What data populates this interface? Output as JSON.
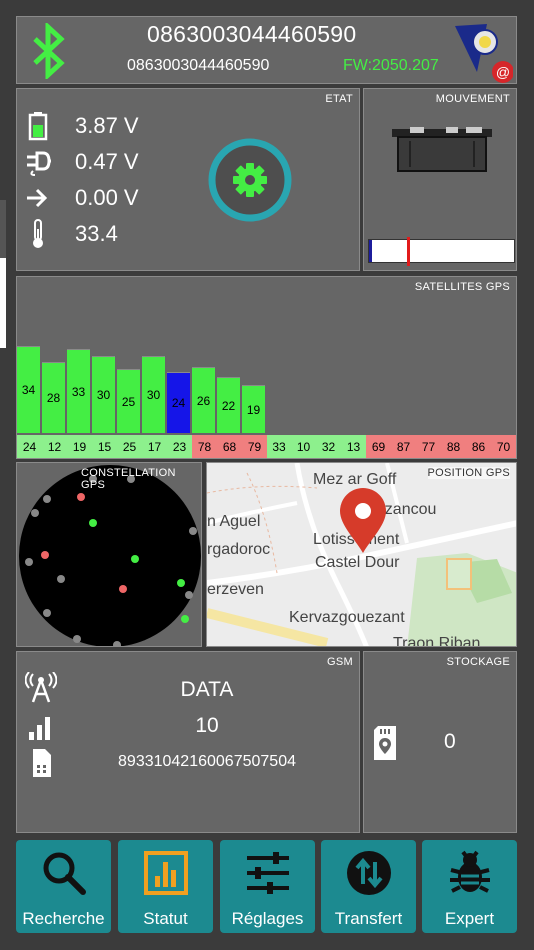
{
  "header": {
    "imei_main": "0863003044460590",
    "imei_sub": "0863003044460590",
    "firmware": "FW:2050.207",
    "logo_badge": "@"
  },
  "etat": {
    "title": "ETAT",
    "battery_voltage": "3.87 V",
    "power_voltage": "0.47 V",
    "input_voltage": "0.00 V",
    "temperature": "33.4"
  },
  "mouvement": {
    "title": "MOUVEMENT",
    "level": 0.26
  },
  "satellites": {
    "title": "SATELLITES GPS",
    "bars": [
      {
        "snr": "34",
        "id": "24",
        "level": 34,
        "color": "#44ee44",
        "label_color": "#8df08d"
      },
      {
        "snr": "28",
        "id": "12",
        "level": 28,
        "color": "#44ee44",
        "label_color": "#8df08d"
      },
      {
        "snr": "33",
        "id": "19",
        "level": 33,
        "color": "#44ee44",
        "label_color": "#8df08d"
      },
      {
        "snr": "30",
        "id": "15",
        "level": 30,
        "color": "#44ee44",
        "label_color": "#8df08d"
      },
      {
        "snr": "25",
        "id": "25",
        "level": 25,
        "color": "#44ee44",
        "label_color": "#8df08d"
      },
      {
        "snr": "30",
        "id": "17",
        "level": 30,
        "color": "#44ee44",
        "label_color": "#8df08d"
      },
      {
        "snr": "24",
        "id": "23",
        "level": 24,
        "color": "#1515e8",
        "label_color": "#8df08d"
      },
      {
        "snr": "26",
        "id": "78",
        "level": 26,
        "color": "#44ee44",
        "label_color": "#f07f7f"
      },
      {
        "snr": "22",
        "id": "68",
        "level": 22,
        "color": "#44ee44",
        "label_color": "#f07f7f"
      },
      {
        "snr": "19",
        "id": "79",
        "level": 19,
        "color": "#44ee44",
        "label_color": "#f07f7f"
      },
      {
        "snr": "",
        "id": "33",
        "level": 0,
        "color": "#44ee44",
        "label_color": "#8df08d"
      },
      {
        "snr": "",
        "id": "10",
        "level": 0,
        "color": "#44ee44",
        "label_color": "#8df08d"
      },
      {
        "snr": "",
        "id": "32",
        "level": 0,
        "color": "#44ee44",
        "label_color": "#8df08d"
      },
      {
        "snr": "",
        "id": "13",
        "level": 0,
        "color": "#44ee44",
        "label_color": "#8df08d"
      },
      {
        "snr": "",
        "id": "69",
        "level": 0,
        "color": "#44ee44",
        "label_color": "#f07f7f"
      },
      {
        "snr": "",
        "id": "87",
        "level": 0,
        "color": "#44ee44",
        "label_color": "#f07f7f"
      },
      {
        "snr": "",
        "id": "77",
        "level": 0,
        "color": "#44ee44",
        "label_color": "#f07f7f"
      },
      {
        "snr": "",
        "id": "88",
        "level": 0,
        "color": "#44ee44",
        "label_color": "#f07f7f"
      },
      {
        "snr": "",
        "id": "86",
        "level": 0,
        "color": "#44ee44",
        "label_color": "#f07f7f"
      },
      {
        "snr": "",
        "id": "70",
        "level": 0,
        "color": "#44ee44",
        "label_color": "#f07f7f"
      }
    ]
  },
  "constellation": {
    "title": "CONSTELLATION GPS"
  },
  "position": {
    "title": "POSITION GPS",
    "places": [
      "Mez ar Goff",
      "Lezancou",
      "n Aguel",
      "rgadoroc",
      "Lotissement",
      "Castel Dour",
      "erzeven",
      "Kervazgouezant",
      "Traon Riban"
    ]
  },
  "gsm": {
    "title": "GSM",
    "mode": "DATA",
    "signal": "10",
    "iccid": "89331042160067507504"
  },
  "stockage": {
    "title": "STOCKAGE",
    "count": "0"
  },
  "nav": [
    {
      "label": "Recherche",
      "icon": "search-icon"
    },
    {
      "label": "Statut",
      "icon": "chart-icon"
    },
    {
      "label": "Réglages",
      "icon": "sliders-icon"
    },
    {
      "label": "Transfert",
      "icon": "transfer-icon"
    },
    {
      "label": "Expert",
      "icon": "bug-icon"
    }
  ],
  "colors": {
    "panel": "#666666",
    "accent_green": "#44ee44",
    "teal": "#1c8a90",
    "snr_blue": "#1515e8"
  }
}
